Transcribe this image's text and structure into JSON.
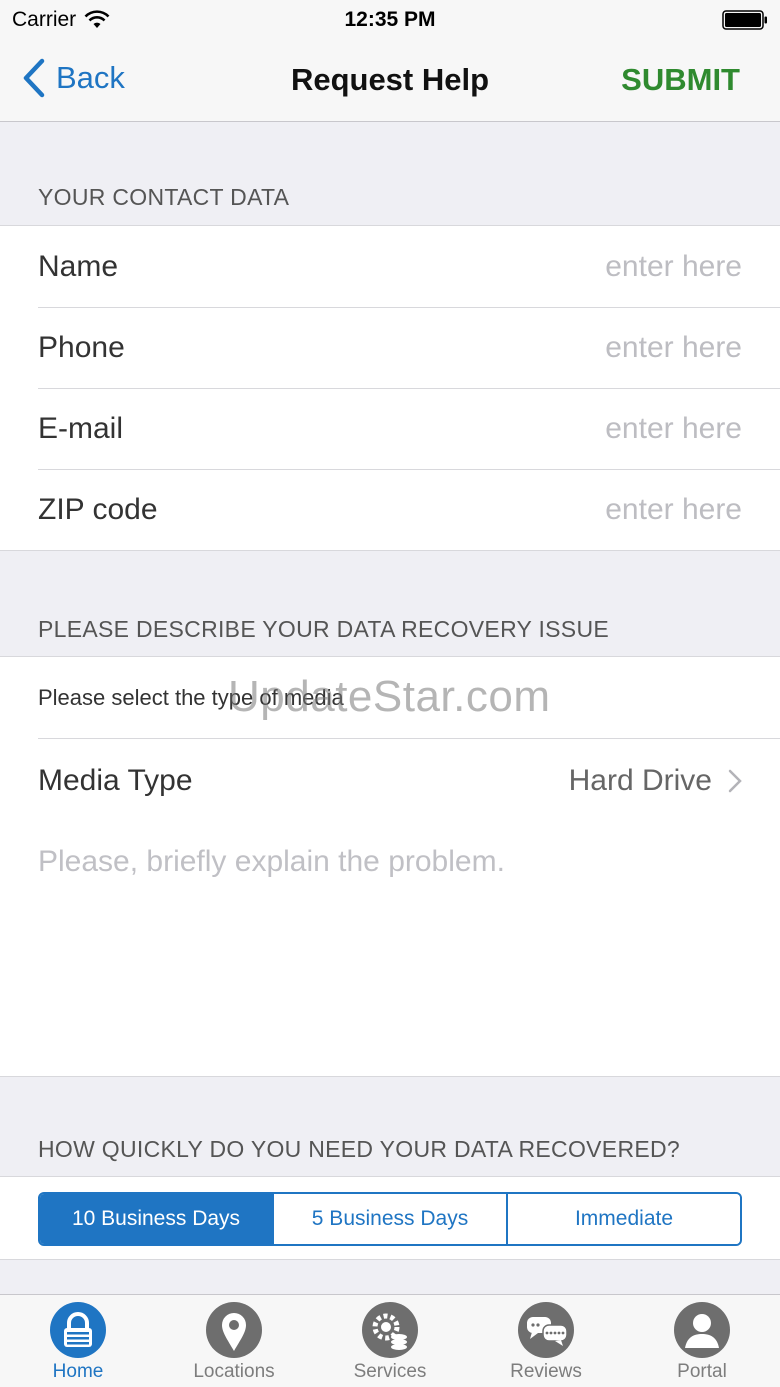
{
  "status_bar": {
    "carrier": "Carrier",
    "time": "12:35 PM"
  },
  "nav": {
    "back_label": "Back",
    "title": "Request Help",
    "submit_label": "SUBMIT"
  },
  "contact_section": {
    "header": "YOUR CONTACT DATA",
    "fields": [
      {
        "label": "Name",
        "placeholder": "enter here",
        "value": ""
      },
      {
        "label": "Phone",
        "placeholder": "enter here",
        "value": ""
      },
      {
        "label": "E-mail",
        "placeholder": "enter here",
        "value": ""
      },
      {
        "label": "ZIP code",
        "placeholder": "enter here",
        "value": ""
      }
    ]
  },
  "issue_section": {
    "header": "PLEASE DESCRIBE YOUR DATA RECOVERY ISSUE",
    "media_hint": "Please select the type of media",
    "media_label": "Media Type",
    "media_value": "Hard Drive",
    "problem_placeholder": "Please, briefly explain the problem."
  },
  "watermark": "UpdateStar.com",
  "speed_section": {
    "header": "HOW QUICKLY DO YOU NEED YOUR DATA RECOVERED?",
    "options": [
      "10 Business Days",
      "5 Business Days",
      "Immediate"
    ],
    "selected_index": 0
  },
  "tabbar": {
    "items": [
      {
        "label": "Home",
        "icon": "lock-icon"
      },
      {
        "label": "Locations",
        "icon": "map-pin-icon"
      },
      {
        "label": "Services",
        "icon": "gear-stack-icon"
      },
      {
        "label": "Reviews",
        "icon": "chat-bubbles-icon"
      },
      {
        "label": "Portal",
        "icon": "user-icon"
      }
    ],
    "active_index": 0
  },
  "colors": {
    "accent": "#1f75c3",
    "submit": "#2f8a2f",
    "tab_icon_inactive": "#6e6e6e"
  }
}
